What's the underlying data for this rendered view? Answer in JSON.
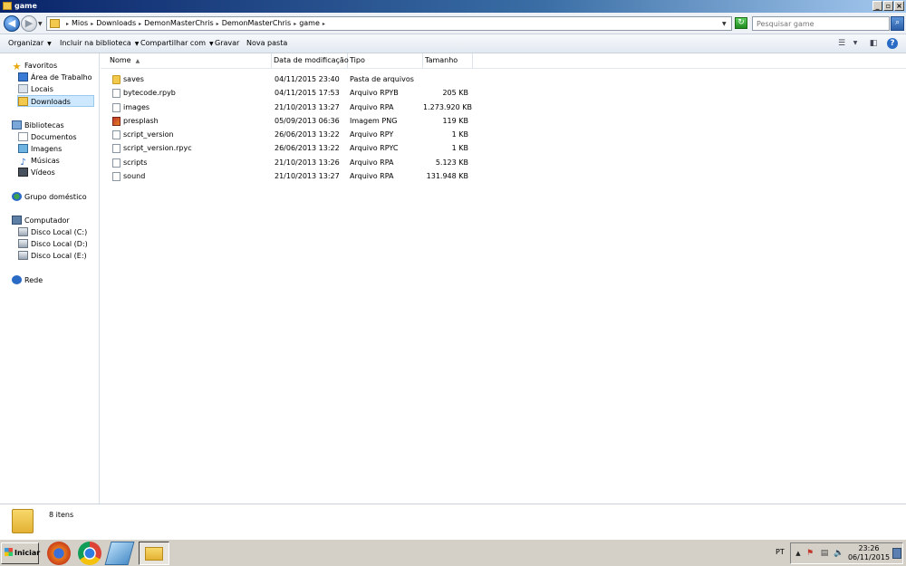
{
  "window": {
    "title": "game",
    "buttons": {
      "minimize": "_",
      "maximize": "▫",
      "close": "×"
    }
  },
  "address": {
    "back_glyph": "◀",
    "forward_glyph": "▶",
    "crumbs": [
      "Mios",
      "Downloads",
      "DemonMasterChris",
      "DemonMasterChris",
      "game"
    ],
    "search_placeholder": "Pesquisar game",
    "refresh_glyph": "↻",
    "search_glyph": "⌕"
  },
  "toolbar": {
    "organize": "Organizar",
    "include_library": "Incluir na biblioteca",
    "share": "Compartilhar com",
    "burn": "Gravar",
    "new_folder": "Nova pasta"
  },
  "sidebar": {
    "favorites": {
      "label": "Favoritos",
      "items": [
        "Área de Trabalho",
        "Locais",
        "Downloads"
      ]
    },
    "libraries": {
      "label": "Bibliotecas",
      "items": [
        "Documentos",
        "Imagens",
        "Músicas",
        "Vídeos"
      ]
    },
    "homegroup": "Grupo doméstico",
    "computer": {
      "label": "Computador",
      "items": [
        "Disco Local (C:)",
        "Disco Local (D:)",
        "Disco Local (E:)"
      ]
    },
    "network": "Rede"
  },
  "columns": {
    "name": "Nome",
    "date": "Data de modificação",
    "type": "Tipo",
    "size": "Tamanho"
  },
  "files": [
    {
      "name": "saves",
      "date": "04/11/2015 23:40",
      "type": "Pasta de arquivos",
      "size": "",
      "icon": "folder"
    },
    {
      "name": "bytecode.rpyb",
      "date": "04/11/2015 17:53",
      "type": "Arquivo RPYB",
      "size": "205 KB",
      "icon": "file"
    },
    {
      "name": "images",
      "date": "21/10/2013 13:27",
      "type": "Arquivo RPA",
      "size": "1.273.920 KB",
      "icon": "file"
    },
    {
      "name": "presplash",
      "date": "05/09/2013 06:36",
      "type": "Imagem PNG",
      "size": "119 KB",
      "icon": "png"
    },
    {
      "name": "script_version",
      "date": "26/06/2013 13:22",
      "type": "Arquivo RPY",
      "size": "1 KB",
      "icon": "file"
    },
    {
      "name": "script_version.rpyc",
      "date": "26/06/2013 13:22",
      "type": "Arquivo RPYC",
      "size": "1 KB",
      "icon": "file"
    },
    {
      "name": "scripts",
      "date": "21/10/2013 13:26",
      "type": "Arquivo RPA",
      "size": "5.123 KB",
      "icon": "file"
    },
    {
      "name": "sound",
      "date": "21/10/2013 13:27",
      "type": "Arquivo RPA",
      "size": "131.948 KB",
      "icon": "file"
    }
  ],
  "details": {
    "count": "8 itens"
  },
  "taskbar": {
    "start": "Iniciar",
    "language": "PT",
    "time": "23:26",
    "date": "06/11/2015"
  }
}
